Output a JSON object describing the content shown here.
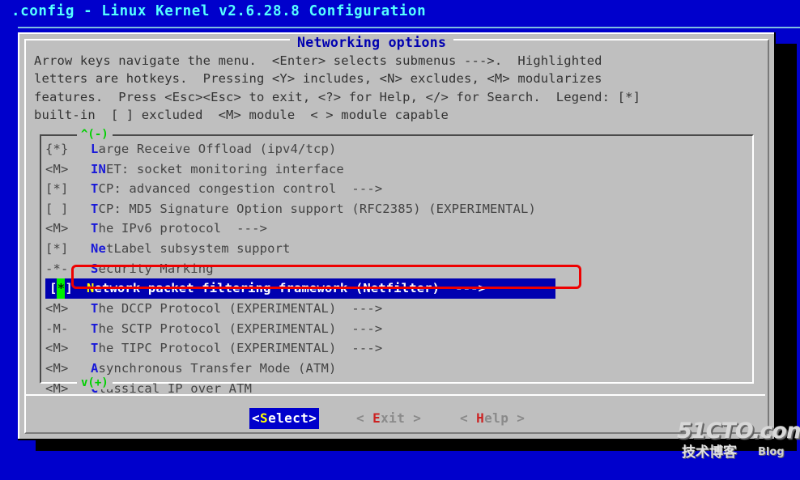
{
  "window": {
    "title": ".config - Linux Kernel v2.6.28.8 Configuration",
    "background_color": "#0000cc",
    "title_color": "#55ffff"
  },
  "dialog": {
    "caption": "Networking options",
    "caption_color": "#0000b0",
    "background_color": "#bfbfbf",
    "help_text": "Arrow keys navigate the menu.  <Enter> selects submenus --->.  Highlighted\nletters are hotkeys.  Pressing <Y> includes, <N> excludes, <M> modularizes\nfeatures.  Press <Esc><Esc> to exit, <?> for Help, </> for Search.  Legend: [*]\nbuilt-in  [ ] excluded  <M> module  < > module capable"
  },
  "list": {
    "scroll_up_indicator": "^(-)",
    "scroll_down_indicator": "v(+)",
    "scroll_indicator_color": "#00d000",
    "selected_index": 7,
    "items": [
      {
        "tag": "{*}",
        "indent": "  ",
        "hotkey": "L",
        "label": "arge Receive Offload (ipv4/tcp)",
        "arrow": ""
      },
      {
        "tag": "<M>",
        "indent": "  ",
        "hotkey": "IN",
        "label": "ET: socket monitoring interface",
        "arrow": ""
      },
      {
        "tag": "[*]",
        "indent": "  ",
        "hotkey": "T",
        "label": "CP: advanced congestion control",
        "arrow": "  --->"
      },
      {
        "tag": "[ ]",
        "indent": "  ",
        "hotkey": "T",
        "label": "CP: MD5 Signature Option support (RFC2385) (EXPERIMENTAL)",
        "arrow": ""
      },
      {
        "tag": "<M>",
        "indent": "  ",
        "hotkey": "T",
        "label": "he IPv6 protocol",
        "arrow": "  --->"
      },
      {
        "tag": "[*]",
        "indent": "  ",
        "hotkey": "Ne",
        "label": "tLabel subsystem support",
        "arrow": ""
      },
      {
        "tag": "-*-",
        "indent": "",
        "hotkey": "S",
        "label": "ecurity Marking",
        "arrow": ""
      },
      {
        "tag": "[*]",
        "indent": "",
        "hotkey": "N",
        "label": "etwork packet filtering framework (Netfilter)",
        "arrow": "  --->",
        "selected": true
      },
      {
        "tag": "<M>",
        "indent": "",
        "hotkey": "T",
        "label": "he DCCP Protocol (EXPERIMENTAL)",
        "arrow": "  --->"
      },
      {
        "tag": "-M-",
        "indent": "",
        "hotkey": "T",
        "label": "he SCTP Protocol (EXPERIMENTAL)",
        "arrow": "  --->"
      },
      {
        "tag": "<M>",
        "indent": "",
        "hotkey": "T",
        "label": "he TIPC Protocol (EXPERIMENTAL)",
        "arrow": "  --->"
      },
      {
        "tag": "<M>",
        "indent": "",
        "hotkey": "A",
        "label": "synchronous Transfer Mode (ATM)",
        "arrow": ""
      },
      {
        "tag": "<M>",
        "indent": "  ",
        "hotkey": "C",
        "label": "lassical IP over ATM",
        "arrow": ""
      }
    ],
    "selected_row": {
      "tag_open": "[",
      "cursor_char": "*",
      "tag_close": "]",
      "hotkey": "N",
      "label": "etwork packet filtering framework (Netfilter)",
      "arrow": "  --->",
      "background_color": "#0000b0",
      "text_color": "#ffffff",
      "hotkey_color": "#ffff00",
      "cursor_color": "#00f000"
    }
  },
  "annotation": {
    "shape": "rectangle",
    "color": "#ee0000",
    "target": "Network packet filtering framework (Netfilter)"
  },
  "buttons": {
    "select": {
      "text": "<Select>",
      "hotkey": "S",
      "prefix": "<",
      "suffix": "elect>",
      "active": true
    },
    "exit": {
      "prefix": "< ",
      "hotkey": "E",
      "suffix": "xit >",
      "active": false
    },
    "help": {
      "prefix": "< ",
      "hotkey": "H",
      "suffix": "elp >",
      "active": false
    }
  },
  "watermark": {
    "main": "51CTO.com",
    "sub": "技术博客",
    "blog": "Blog"
  }
}
